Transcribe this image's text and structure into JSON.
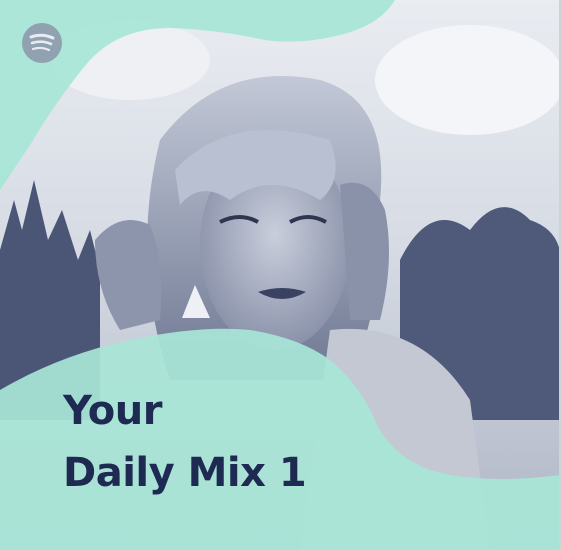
{
  "cover": {
    "title_line_1": "Your",
    "title_line_2": "Daily Mix 1",
    "logo_icon": "spotify-logo-icon",
    "colors": {
      "accent_mint": "#a8e6d7",
      "title_navy": "#1f2a52",
      "photo_tint": "#4b5677"
    }
  }
}
